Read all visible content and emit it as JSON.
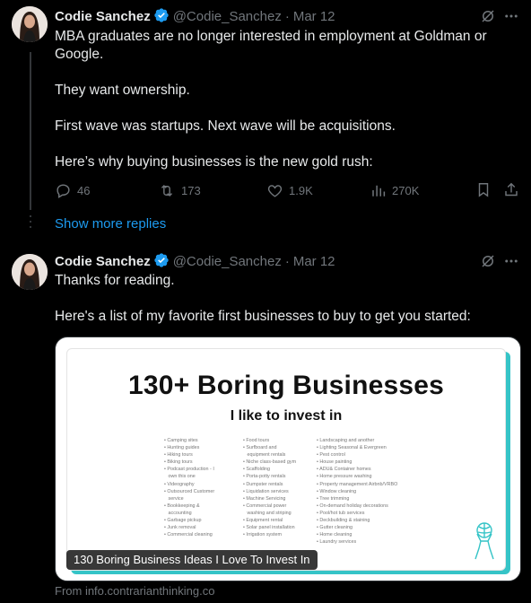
{
  "tweet1": {
    "author_name": "Codie Sanchez",
    "author_handle": "@Codie_Sanchez",
    "separator": "·",
    "date": "Mar 12",
    "lines": [
      "MBA graduates are no longer interested in employment at Goldman or",
      "Google.",
      "They want ownership.",
      "First wave was startups. Next wave will be acquisitions.",
      "Here’s why buying businesses is the new gold rush:"
    ],
    "replies": "46",
    "reposts": "173",
    "likes": "1.9K",
    "views": "270K"
  },
  "show_more": "Show more replies",
  "tweet2": {
    "author_name": "Codie Sanchez",
    "author_handle": "@Codie_Sanchez",
    "separator": "·",
    "date": "Mar 12",
    "lines": [
      "Thanks for reading.",
      "Here's a list of my favorite first businesses to buy to get you started:"
    ],
    "card": {
      "image_title": "130+ Boring Businesses",
      "image_subtitle": "I like to invest in",
      "col1": [
        "Camping sites",
        "Hunting guides",
        "Hiking tours",
        "Biking tours",
        "Podcast production - I",
        "own this one",
        "Videography",
        "Outsourced Customer",
        "service",
        "Bookkeeping &",
        "accounting",
        "Garbage pickup",
        "Junk removal",
        "Commercial cleaning"
      ],
      "col2": [
        "Food tours",
        "Surfboard and",
        "equipment rentals",
        "Niche class-based gym",
        "Scaffolding",
        "Porta-potty rentals",
        "Dumpster rentals",
        "Liquidation services",
        "Machine Servicing",
        "Commercial power",
        "washing and striping",
        "Equipment rental",
        "Solar panel installation",
        "Irrigation system"
      ],
      "col3": [
        "Landscaping and another",
        "Lighting Seasonal & Evergreen",
        "Pest control",
        "House painting",
        "ADU& Container homes",
        "Home pressure washing",
        "Property management Airbnb/VRBO",
        "Window cleaning",
        "Tree trimming",
        "On-demand holiday decorations",
        "Pool/hot tub services",
        "Deckbuilding & staining",
        "Gutter cleaning",
        "Home cleaning",
        "Laundry services"
      ],
      "caption": "130 Boring Business Ideas I Love To Invest In",
      "source": "From info.contrarianthinking.co"
    }
  },
  "colors": {
    "background": "#000000",
    "text": "#e7e9ea",
    "muted": "#71767b",
    "link": "#1d9bf0",
    "verified": "#1d9bf0",
    "card_accent": "#35c4c7"
  }
}
